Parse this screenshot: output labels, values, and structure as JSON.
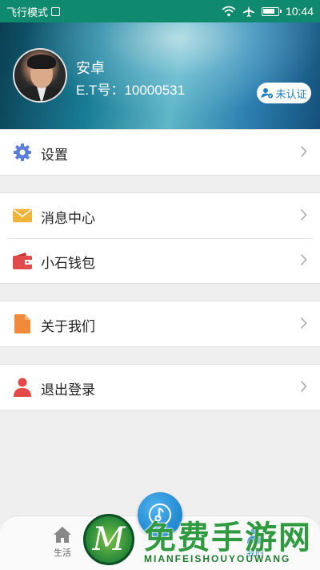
{
  "status_bar": {
    "mode_text": "飞行模式",
    "time": "10:44",
    "icons": [
      "image-box-icon",
      "wifi-icon",
      "airplane-icon",
      "battery-icon"
    ]
  },
  "profile": {
    "name": "安卓",
    "user_id": "E.T号：10000531",
    "verify_label": "未认证",
    "verify_color": "#1f7fc2"
  },
  "menu_groups": [
    [
      {
        "label": "设置",
        "icon": "gear-icon",
        "color": "#5b7ed8"
      }
    ],
    [
      {
        "label": "消息中心",
        "icon": "envelope-icon",
        "color": "#f0b43a"
      },
      {
        "label": "小石钱包",
        "icon": "wallet-icon",
        "color": "#e04a4a"
      }
    ],
    [
      {
        "label": "关于我们",
        "icon": "document-icon",
        "color": "#f08a3a"
      }
    ],
    [
      {
        "label": "退出登录",
        "icon": "person-icon",
        "color": "#e54848"
      }
    ]
  ],
  "bottom_nav": {
    "items": [
      {
        "label": "生活",
        "icon": "home-icon"
      },
      {
        "label": "我的",
        "icon": "person-icon",
        "active": true
      }
    ],
    "accent": "#1f7fc2"
  },
  "watermark": {
    "logo_letter": "M",
    "title": "免费手游网",
    "subtitle": "MIANFEISHOUYOUWANG"
  }
}
